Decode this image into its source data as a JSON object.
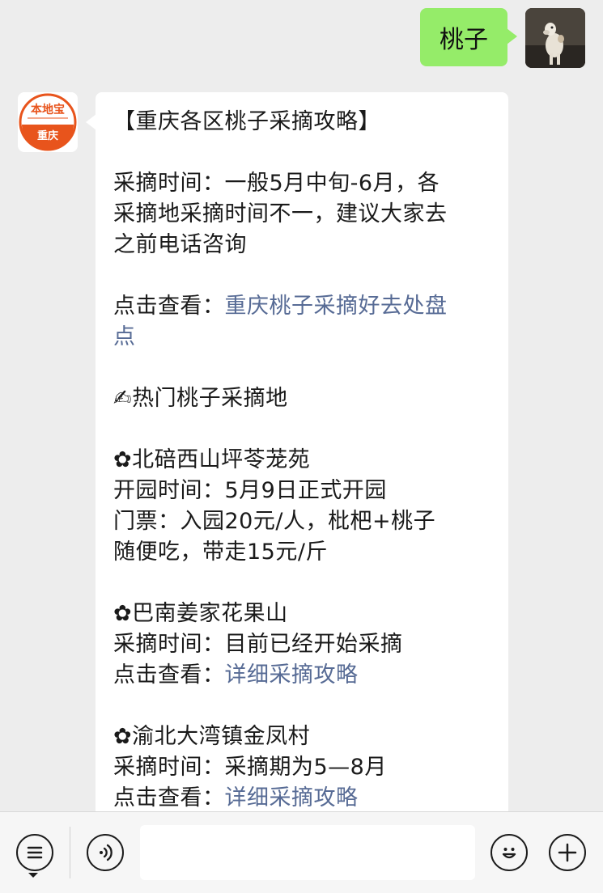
{
  "outgoing": {
    "text": "桃子"
  },
  "incoming": {
    "avatar": {
      "brand": "本地宝",
      "city": "重庆"
    },
    "lines": [
      {
        "t": "【重庆各区桃子采摘攻略】"
      },
      {
        "gap": true
      },
      {
        "t": "采摘时间：一般5月中旬-6月，各"
      },
      {
        "t": "采摘地采摘时间不一，建议大家去"
      },
      {
        "t": "之前电话咨询"
      },
      {
        "gap": true
      },
      {
        "t": "点击查看：",
        "link": "重庆桃子采摘好去处盘"
      },
      {
        "link": "点"
      },
      {
        "gap": true
      },
      {
        "t": "✍热门桃子采摘地"
      },
      {
        "gap": true
      },
      {
        "t": "✿北碚西山坪苓茏苑"
      },
      {
        "t": "开园时间：5月9日正式开园"
      },
      {
        "t": "门票：入园20元/人，枇杷+桃子"
      },
      {
        "t": "随便吃，带走15元/斤"
      },
      {
        "gap": true
      },
      {
        "t": "✿巴南姜家花果山"
      },
      {
        "t": "采摘时间：目前已经开始采摘"
      },
      {
        "t": "点击查看：",
        "link": "详细采摘攻略"
      },
      {
        "gap": true
      },
      {
        "t": "✿渝北大湾镇金凤村"
      },
      {
        "t": "采摘时间：采摘期为5—8月"
      },
      {
        "t": "点击查看：",
        "link": "详细采摘攻略"
      }
    ]
  },
  "toolbar": {
    "menu_icon": "menu-list-icon",
    "voice_icon": "voice-icon",
    "emoji_icon": "emoji-icon",
    "plus_icon": "plus-icon"
  }
}
